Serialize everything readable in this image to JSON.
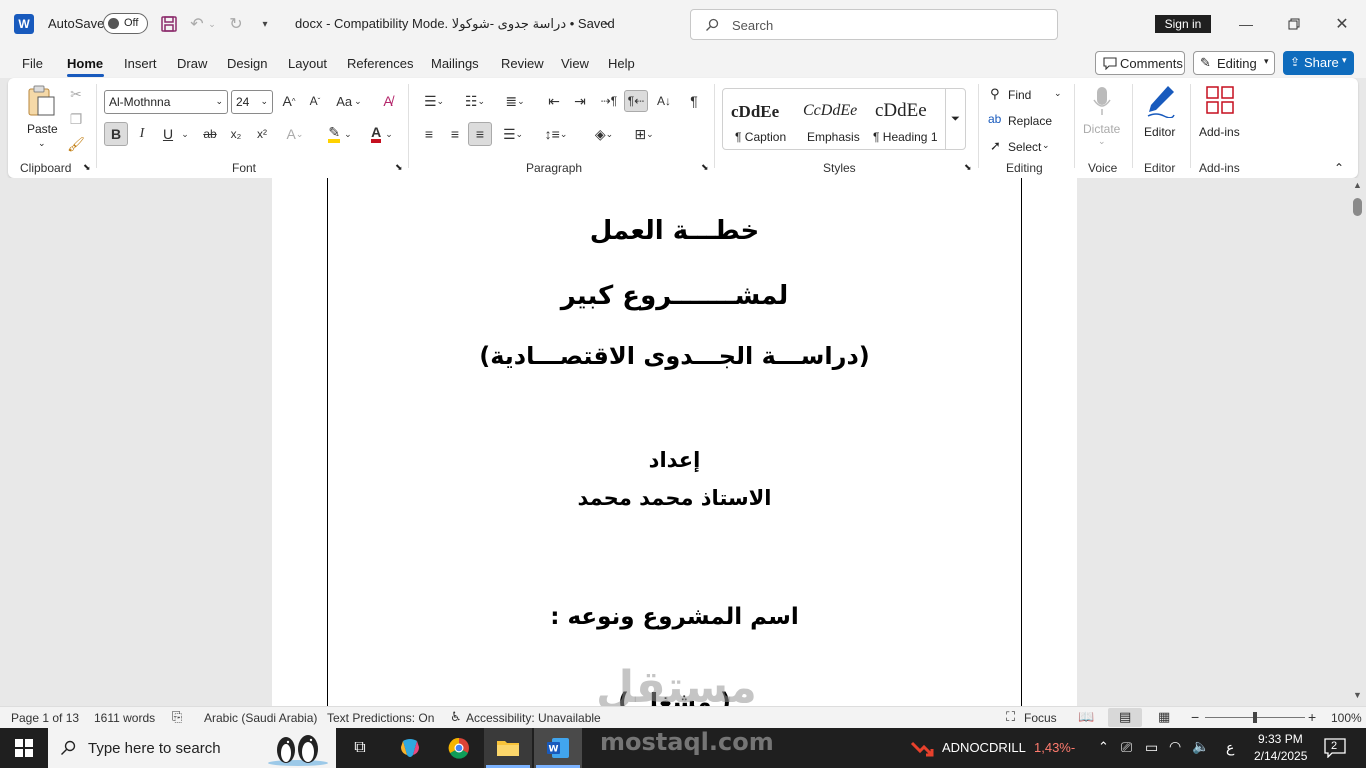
{
  "titlebar": {
    "app_glyph": "W",
    "autosave_label": "AutoSave",
    "autosave_state": "Off",
    "doc_title": "docx  -  Compatibility Mode. دراسة جدوى -شوكولا • Saved",
    "search_placeholder": "Search",
    "sign_in": "Sign in"
  },
  "menu": {
    "tabs": [
      "File",
      "Home",
      "Insert",
      "Draw",
      "Design",
      "Layout",
      "References",
      "Mailings",
      "Review",
      "View",
      "Help"
    ],
    "comments": "Comments",
    "editing": "Editing",
    "share": "Share"
  },
  "ribbon": {
    "clipboard": {
      "paste": "Paste",
      "group": "Clipboard"
    },
    "font": {
      "name": "Al-Mothnna",
      "size": "24",
      "group": "Font",
      "bold": "B",
      "italic": "I",
      "underline": "U",
      "case": "Aa"
    },
    "paragraph": {
      "group": "Paragraph"
    },
    "styles": {
      "group": "Styles",
      "items": [
        {
          "sample": "cDdEe",
          "label": "¶ Caption"
        },
        {
          "sample": "CcDdEe",
          "label": "Emphasis"
        },
        {
          "sample": "cDdEe",
          "label": "¶ Heading 1"
        }
      ]
    },
    "editing": {
      "find": "Find",
      "replace": "Replace",
      "select": "Select",
      "group": "Editing"
    },
    "voice": {
      "dictate": "Dictate",
      "group": "Voice"
    },
    "editor": {
      "label": "Editor",
      "group": "Editor"
    },
    "addins": {
      "label": "Add-ins",
      "group": "Add-ins"
    }
  },
  "document": {
    "line1": "خطـــة العمل",
    "line2": "لمشـــــــروع كبير",
    "line3": "(دراســـة الجـــدوى الاقتصـــادية)",
    "line4": "إعداد",
    "line5": "الاستاذ محمد محمد",
    "line6": "اسم المشروع ونوعه :",
    "line7_partial": "( مشغل )"
  },
  "status": {
    "page": "Page 1 of 13",
    "words": "1611 words",
    "language": "Arabic (Saudi Arabia)",
    "predictions": "Text Predictions: On",
    "accessibility": "Accessibility: Unavailable",
    "focus": "Focus",
    "zoom": "100%",
    "zoom_fraction": 0.5
  },
  "taskbar": {
    "search_placeholder": "Type here to search",
    "stock_name": "ADNOCDRILL",
    "stock_change": "-1,43%",
    "ime": "ع",
    "time": "9:33 PM",
    "date": "2/14/2025",
    "notifications": "2"
  },
  "watermark": {
    "arabic": "مستقل",
    "latin": "mostaql.com"
  },
  "colors": {
    "word_blue": "#185abd",
    "share_blue": "#0f6cbd",
    "accent_red": "#c50f1f"
  }
}
